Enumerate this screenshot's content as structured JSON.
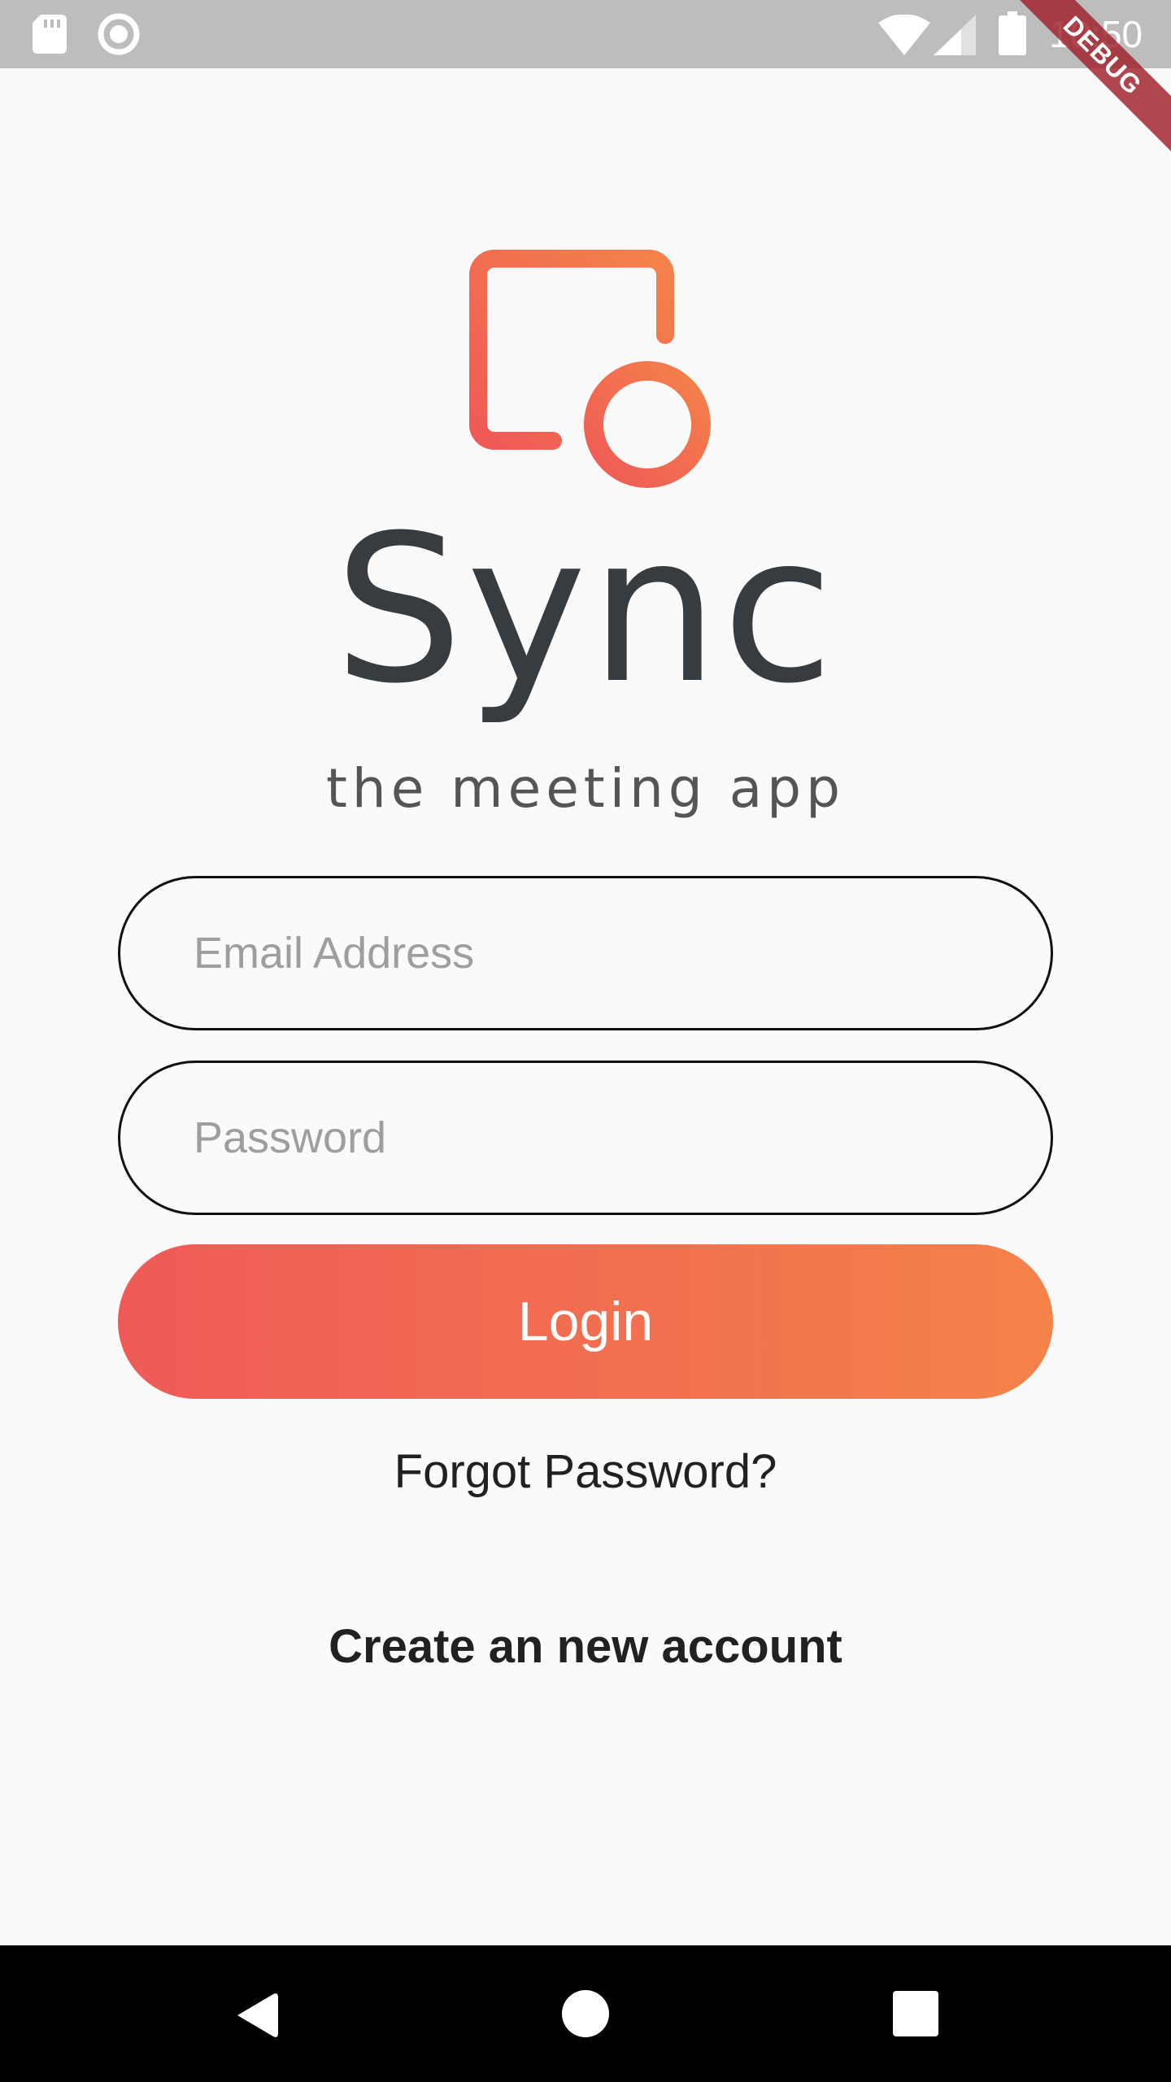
{
  "status_bar": {
    "time": "10:50",
    "icons": [
      "sd-card-icon",
      "record-icon",
      "wifi-icon",
      "signal-icon",
      "battery-icon"
    ]
  },
  "debug_banner": "DEBUG",
  "branding": {
    "icon": "calendar-add-icon",
    "app_name": "Sync",
    "tagline": "the meeting app",
    "colors": {
      "gradient_start": "#ef5a57",
      "gradient_end": "#f48249",
      "name_color": "#373c41"
    }
  },
  "form": {
    "email_placeholder": "Email Address",
    "email_value": "",
    "password_placeholder": "Password",
    "password_value": "",
    "login_label": "Login",
    "forgot_label": "Forgot Password?",
    "create_label": "Create an new account"
  },
  "nav_bar": {
    "icons": [
      "back-icon",
      "home-icon",
      "recents-icon"
    ]
  }
}
